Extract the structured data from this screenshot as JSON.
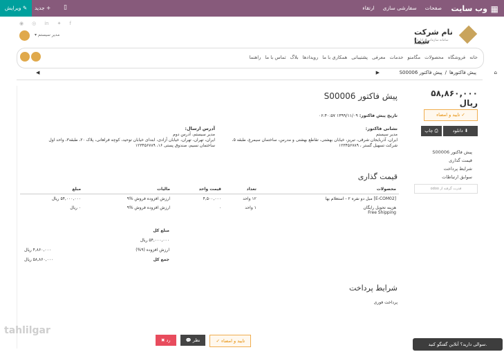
{
  "topbar": {
    "brand": "وب سایت",
    "menu": [
      "صفحات",
      "سفارشی سازی",
      "ارتقاء"
    ],
    "new_label": "جدید",
    "edit_label": "ویرایش"
  },
  "header": {
    "user_label": "مدیر سیستم",
    "logo_name": "نام شرکت شما",
    "logo_tagline": "سامانه سازمانی از اداره تا فروشگاه",
    "social_icons": [
      "facebook-icon",
      "twitter-icon",
      "linkedin-icon",
      "instagram-icon",
      "pinterest-icon"
    ]
  },
  "nav": {
    "items": [
      "خانه",
      "فروشگاه",
      "محصولات",
      "مگامنو",
      "خدمات",
      "معرفی",
      "پشتیبانی",
      "همکاری با ما",
      "رویدادها",
      "بلاگ",
      "تماس با ما",
      "راهنما"
    ]
  },
  "breadcrumb": {
    "items": [
      "پیش فاکتورها",
      "پیش فاکتور S00006"
    ]
  },
  "sidebar": {
    "total": "۵۸,۸۶۰,۰۰۰ ریال",
    "accept_label": "تایید و امضاء",
    "download_label": "دانلود",
    "print_label": "چاپ",
    "links": [
      "پیش فاکتور S00006",
      "قیمت گذاری",
      "شرایط پرداخت",
      "سوابق ارتباطات"
    ],
    "odoo": "قدرت گرفته از odoo"
  },
  "main": {
    "title": "پیش فاکتور S00006",
    "date_label": "تاریخ پیش فاکتور:",
    "date_value": "۱۳۹۹/۱۱/۰۹ ۰۶:۴۰:۵۷",
    "invoice_addr_title": "نشانی فاکتور:",
    "invoice_addr": "مدیر سیستم\nایران، آذربایجان شرقی، تبریز، خیابان بهشتی، تقاطع بهشتی و مدرس، ساختمان سیمرغ، طبقه ۵، شرکت تسهیل گستر ، ۱۲۳۴۵۶۷۸۹",
    "shipping_addr_title": "آدرس ارسال:",
    "shipping_addr": "مدیر سیستم، آدرس دوم\nایران، تهران، تهران، خیابان آزادی، ابتدای خیابان توحید، کوچه فراهانی، پلاک ۲۰، طبقه۳، واحد اول ساختمان نسیم، صندوق پستی ۱۶، ۱۲۳۴۵۶۷۸۹",
    "pricing_title": "قیمت گذاری",
    "columns": [
      "محصولات",
      "تعداد",
      "قیمت واحد",
      "مالیات",
      "مبلغ"
    ],
    "rows": [
      [
        "[E-COM02] مبل دو نفره ۲ - استعلام بها",
        "۱۲ واحد",
        "۴,۵۰۰,۰۰۰",
        "ارزش افزوده فروش %۹",
        "۵۴,۰۰۰,۰۰۰ ریال"
      ],
      [
        "هزینه تحویل رایگان\nFree Shipping",
        "۱ واحد",
        "۰",
        "ارزش افزوده فروش %۹",
        "۰ ریال"
      ]
    ],
    "subtotal_label": "مبلغ کل",
    "subtotal_value": "۵۴,۰۰۰,۰۰۰ ریال",
    "tax_label": "ارزش افزوده (۹%)",
    "tax_value": "۴,۸۶۰,۰۰۰ ریال",
    "total_label": "جمع کل",
    "total_value": "۵۸,۸۶۰,۰۰۰ ریال",
    "payment_title": "شرایط پرداخت",
    "payment_text": "پرداخت فوری"
  },
  "footer": {
    "reject_label": "رد",
    "comment_label": "نظر",
    "accept_label": "تایید و امضاء",
    "chat_label": "سوالی دارید؟ آنلاین گفتگو کنید."
  },
  "watermark": "tahlilgar"
}
